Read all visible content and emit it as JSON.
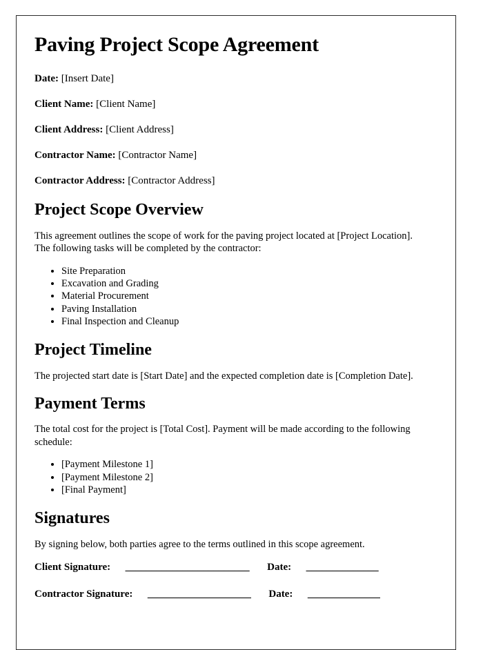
{
  "document": {
    "title": "Paving Project Scope Agreement",
    "meta_fields": [
      {
        "label": "Date:",
        "value": "[Insert Date]"
      },
      {
        "label": "Client Name:",
        "value": "[Client Name]"
      },
      {
        "label": "Client Address:",
        "value": "[Client Address]"
      },
      {
        "label": "Contractor Name:",
        "value": "[Contractor Name]"
      },
      {
        "label": "Contractor Address:",
        "value": "[Contractor Address]"
      }
    ],
    "sections": {
      "scope_overview": {
        "heading": "Project Scope Overview",
        "paragraph": "This agreement outlines the scope of work for the paving project located at [Project Location]. The following tasks will be completed by the contractor:",
        "tasks": [
          "Site Preparation",
          "Excavation and Grading",
          "Material Procurement",
          "Paving Installation",
          "Final Inspection and Cleanup"
        ]
      },
      "timeline": {
        "heading": "Project Timeline",
        "paragraph": "The projected start date is [Start Date] and the expected completion date is [Completion Date]."
      },
      "payment_terms": {
        "heading": "Payment Terms",
        "paragraph": "The total cost for the project is [Total Cost]. Payment will be made according to the following schedule:",
        "milestones": [
          "[Payment Milestone 1]",
          "[Payment Milestone 2]",
          "[Final Payment]"
        ]
      },
      "signatures": {
        "heading": "Signatures",
        "paragraph": "By signing below, both parties agree to the terms outlined in this scope agreement.",
        "client_signature_label": "Client Signature:",
        "client_signature_rule": "________________________",
        "client_date_label": "Date:",
        "client_date_rule": "______________",
        "contractor_signature_label": "Contractor Signature:",
        "contractor_signature_rule": "____________________",
        "contractor_date_label": "Date:",
        "contractor_date_rule": "______________"
      }
    }
  },
  "colors": {
    "page_border": "#2b2b2b",
    "text": "#000000",
    "background": "#ffffff"
  }
}
